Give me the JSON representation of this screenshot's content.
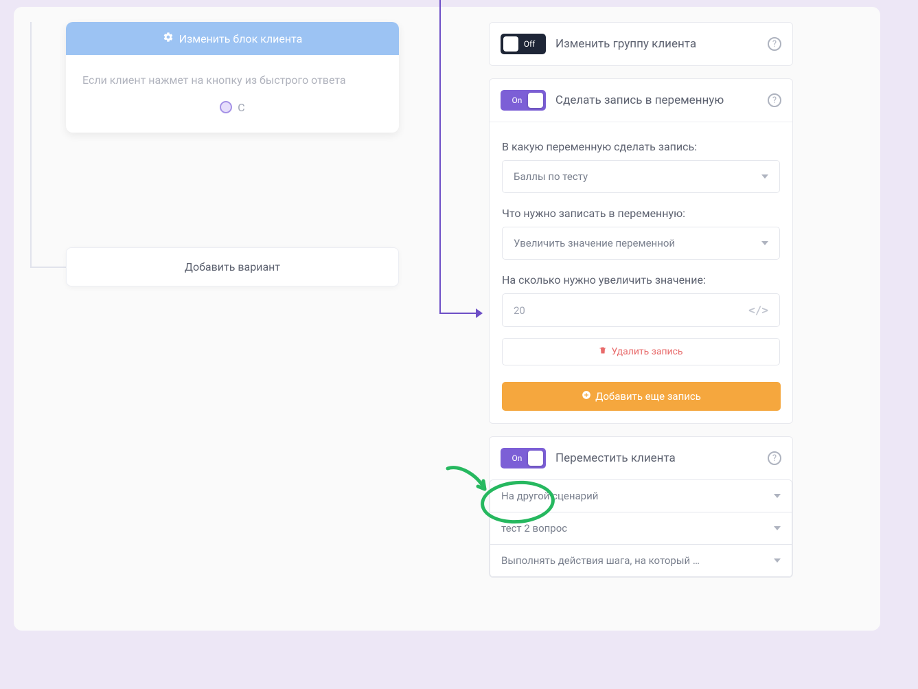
{
  "left": {
    "header": "Изменить блок клиента",
    "note": "Если клиент нажмет на кнопку из быстрого ответа",
    "radio_label": "С",
    "add_variant": "Добавить вариант"
  },
  "toggle": {
    "on": "On",
    "off": "Off"
  },
  "right": {
    "change_group": {
      "title": "Изменить группу клиента"
    },
    "write_var": {
      "title": "Сделать запись в переменную",
      "which_label": "В какую переменную сделать запись:",
      "which_value": "Баллы по тесту",
      "what_label": "Что нужно записать в переменную:",
      "what_value": "Увеличить значение переменной",
      "amount_label": "На сколько нужно увеличить значение:",
      "amount_value": "20",
      "delete": "Удалить запись",
      "add": "Добавить еще запись"
    },
    "move_client": {
      "title": "Переместить клиента",
      "opt1": "На другой сценарий",
      "opt2": "тест 2 вопрос",
      "opt3": "Выполнять действия шага, на который …"
    }
  }
}
